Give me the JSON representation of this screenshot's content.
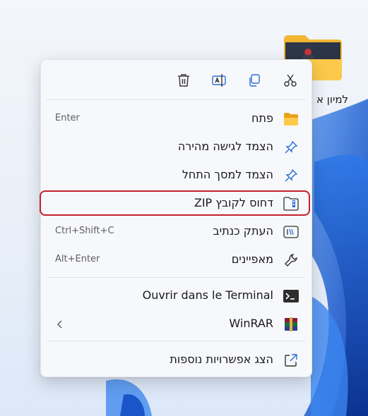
{
  "desktop": {
    "folder": {
      "label": "למיון א"
    }
  },
  "context_menu": {
    "toolbar": {
      "buttons": [
        {
          "name": "cut",
          "icon": "scissors-icon"
        },
        {
          "name": "copy",
          "icon": "copy-icon"
        },
        {
          "name": "rename",
          "icon": "rename-icon"
        },
        {
          "name": "delete",
          "icon": "trash-icon"
        }
      ]
    },
    "items": [
      {
        "label": "פתח",
        "shortcut": "Enter",
        "icon": "folder-open-icon"
      },
      {
        "label": "הצמד לגישה מהירה",
        "shortcut": "",
        "icon": "pin-icon"
      },
      {
        "label": "הצמד למסך התחל",
        "shortcut": "",
        "icon": "pin-icon"
      },
      {
        "label": "דחוס לקובץ ZIP",
        "shortcut": "",
        "icon": "zip-icon"
      },
      {
        "label": "העתק כנתיב",
        "shortcut": "Ctrl+Shift+C",
        "icon": "copy-path-icon"
      },
      {
        "label": "מאפיינים",
        "shortcut": "Alt+Enter",
        "icon": "wrench-icon"
      },
      {
        "label": "Ouvrir dans le Terminal",
        "shortcut": "",
        "icon": "terminal-icon"
      },
      {
        "label": "WinRAR",
        "shortcut": "",
        "icon": "winrar-icon",
        "has_submenu": true
      },
      {
        "label": "הצג אפשרויות נוספות",
        "shortcut": "",
        "icon": "share-external-icon"
      }
    ],
    "highlighted_item": "דחוס לקובץ ZIP"
  },
  "colors": {
    "highlight_border": "#c3212b",
    "menu_bg": "#f7f8fb",
    "wallpaper_blue": "#1e5fd6"
  }
}
